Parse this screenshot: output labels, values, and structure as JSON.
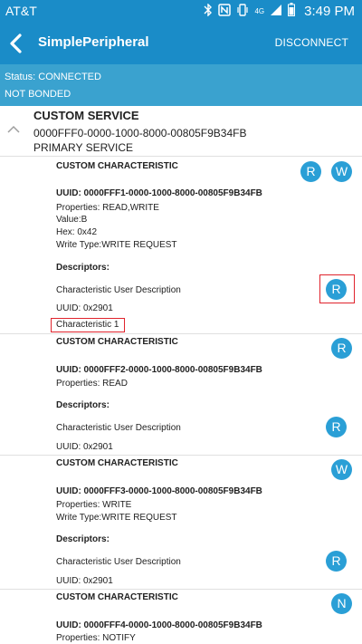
{
  "status_bar": {
    "carrier": "AT&T",
    "icons": [
      "bluetooth-icon",
      "nfc-icon",
      "vibrate-icon",
      "4g-lte-icon",
      "signal-icon",
      "battery-icon"
    ],
    "network": "4G",
    "time": "3:49 PM"
  },
  "app_bar": {
    "title": "SimplePeripheral",
    "disconnect_label": "DISCONNECT"
  },
  "status": {
    "connection": "Status: CONNECTED",
    "bond": "NOT BONDED"
  },
  "service": {
    "name": "CUSTOM SERVICE",
    "uuid": "0000FFF0-0000-1000-8000-00805F9B34FB",
    "type": "PRIMARY SERVICE"
  },
  "characteristics": [
    {
      "title": "CUSTOM CHARACTERISTIC",
      "uuid": "UUID: 0000FFF1-0000-1000-8000-00805F9B34FB",
      "properties": "Properties: READ,WRITE",
      "value": "Value:B",
      "hex": "Hex: 0x42",
      "write_type": "Write Type:WRITE REQUEST",
      "descriptors_label": "Descriptors:",
      "descriptor_name": "Characteristic User Description",
      "descriptor_uuid": "UUID: 0x2901",
      "descriptor_value": "Characteristic 1",
      "buttons": [
        "R",
        "W"
      ],
      "descriptor_button": "R"
    },
    {
      "title": "CUSTOM CHARACTERISTIC",
      "uuid": "UUID: 0000FFF2-0000-1000-8000-00805F9B34FB",
      "properties": "Properties: READ",
      "descriptors_label": "Descriptors:",
      "descriptor_name": "Characteristic User Description",
      "descriptor_uuid": "UUID: 0x2901",
      "buttons": [
        "R"
      ],
      "descriptor_button": "R"
    },
    {
      "title": "CUSTOM CHARACTERISTIC",
      "uuid": "UUID: 0000FFF3-0000-1000-8000-00805F9B34FB",
      "properties": "Properties: WRITE",
      "write_type": "Write Type:WRITE REQUEST",
      "descriptors_label": "Descriptors:",
      "descriptor_name": "Characteristic User Description",
      "descriptor_uuid": "UUID: 0x2901",
      "buttons": [
        "W"
      ],
      "descriptor_button": "R"
    },
    {
      "title": "CUSTOM CHARACTERISTIC",
      "uuid": "UUID: 0000FFF4-0000-1000-8000-00805F9B34FB",
      "properties": "Properties: NOTIFY",
      "buttons": [
        "N"
      ]
    }
  ],
  "colors": {
    "primary": "#1a8cc8",
    "status_strip": "#3aa2cf",
    "action_circle": "#2a9fd6",
    "highlight": "#e0232c"
  }
}
